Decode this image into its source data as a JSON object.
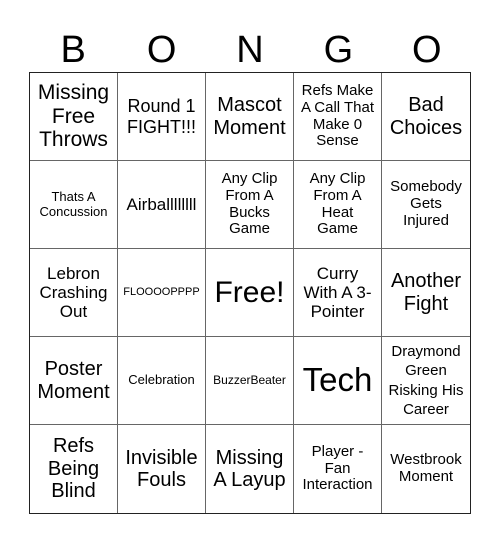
{
  "title_letters": [
    "B",
    "O",
    "N",
    "G",
    "O"
  ],
  "cells": [
    [
      "Missing Free Throws",
      "Round 1 FIGHT!!!",
      "Mascot Moment",
      "Refs Make A Call That Make 0 Sense",
      "Bad Choices"
    ],
    [
      "Thats A Concussion",
      "Airballllllll",
      "Any Clip From A Bucks Game",
      "Any Clip From A Heat Game",
      "Somebody Gets Injured"
    ],
    [
      "Lebron Crashing Out",
      "FLOOOOPPPP",
      "Free!",
      "Curry With A 3-Pointer",
      "Another Fight"
    ],
    [
      "Poster Moment",
      "Celebration",
      "BuzzerBeater",
      "Tech",
      "Draymond Green Risking His Career"
    ],
    [
      "Refs Being Blind",
      "Invisible Fouls",
      "Missing A Layup",
      "Player - Fan Interaction",
      "Westbrook Moment"
    ]
  ]
}
